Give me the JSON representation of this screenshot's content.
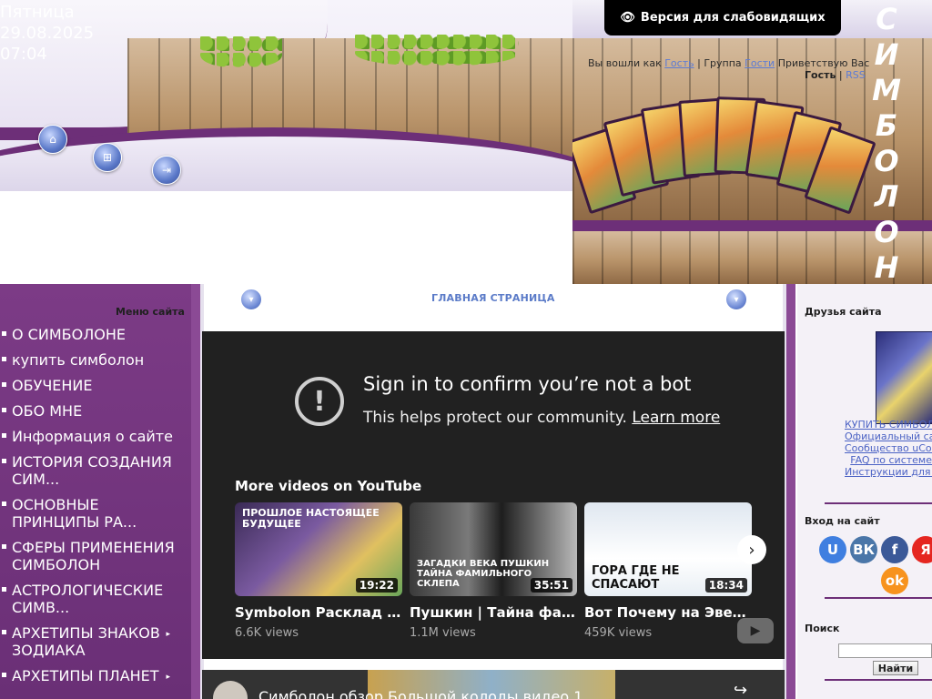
{
  "header": {
    "date": {
      "weekday": "Пятница",
      "date": "29.08.2025",
      "time": "07:04"
    },
    "nav_icons": [
      "home-icon",
      "register-icon",
      "login-icon"
    ],
    "accessibility_button": "Версия для слабовидящих",
    "welcome": {
      "prefix": "Вы вошли как",
      "user": "Гость",
      "group_label": "Группа",
      "group": "Гости",
      "greeting": "Приветствую Вас"
    },
    "guest_line": {
      "name": "Гость",
      "sep": "|",
      "rss": "RSS"
    },
    "logo_text": "СИМБОЛОН"
  },
  "sidebar": {
    "title": "Меню сайта",
    "items": [
      {
        "label": "О СИМБОЛОНЕ",
        "has_sub": false
      },
      {
        "label": "купить симболон",
        "has_sub": false
      },
      {
        "label": "ОБУЧЕНИЕ",
        "has_sub": false
      },
      {
        "label": "ОБО МНЕ",
        "has_sub": false
      },
      {
        "label": "Информация о сайте",
        "has_sub": false
      },
      {
        "label": "ИСТОРИЯ СОЗДАНИЯ СИМ...",
        "has_sub": false
      },
      {
        "label": "ОСНОВНЫЕ ПРИНЦИПЫ РА...",
        "has_sub": false
      },
      {
        "label": "СФЕРЫ ПРИМЕНЕНИЯ СИМБОЛОН",
        "has_sub": false
      },
      {
        "label": "АСТРОЛОГИЧЕСКИЕ СИМВ...",
        "has_sub": false
      },
      {
        "label": "АРХЕТИПЫ ЗНАКОВ ЗОДИАКА",
        "has_sub": true
      },
      {
        "label": "АРХЕТИПЫ ПЛАНЕТ",
        "has_sub": true
      }
    ]
  },
  "main": {
    "page_title": "ГЛАВНАЯ СТРАНИЦА",
    "youtube": {
      "signin_title": "Sign in to confirm you’re not a bot",
      "protect_text": "This helps protect our community.",
      "learn_more": "Learn more",
      "more_videos": "More videos on YouTube",
      "videos": [
        {
          "title": "Symbolon Расклад Что…",
          "views": "6.6K views",
          "duration": "19:22",
          "caption": "ПРОШЛОЕ НАСТОЯЩЕЕ БУДУЩЕЕ"
        },
        {
          "title": "Пушкин | Тайна фамил…",
          "views": "1.1M views",
          "duration": "35:51",
          "caption": "ЗАГАДКИ ВЕКА ПУШКИН ТАЙНА ФАМИЛЬНОГО СКЛЕПА"
        },
        {
          "title": "Вот Почему на Эверес…",
          "views": "459K views",
          "duration": "18:34",
          "caption": "ГОРА ГДЕ НЕ СПАСАЮТ"
        }
      ]
    },
    "youtube2": {
      "title": "Симболон обзор Большой колоды видео 1"
    }
  },
  "right": {
    "friends_title": "Друзья сайта",
    "friends_links": [
      "КУПИТЬ СИМБОЛОН",
      "Официальный сайт",
      "Сообщество uCoz",
      "FAQ по системе",
      "Инструкции для uCoz"
    ],
    "login_title": "Вход на сайт",
    "social": [
      {
        "name": "ucoz",
        "glyph": "U",
        "color": "#3f7fe0"
      },
      {
        "name": "vk",
        "glyph": "ВК",
        "color": "#4a76a8"
      },
      {
        "name": "facebook",
        "glyph": "f",
        "color": "#3b5998"
      },
      {
        "name": "yandex",
        "glyph": "Я",
        "color": "#e52620"
      },
      {
        "name": "odnoklassniki",
        "glyph": "ok",
        "color": "#f7931e"
      }
    ],
    "search_title": "Поиск",
    "search_button": "Найти"
  }
}
